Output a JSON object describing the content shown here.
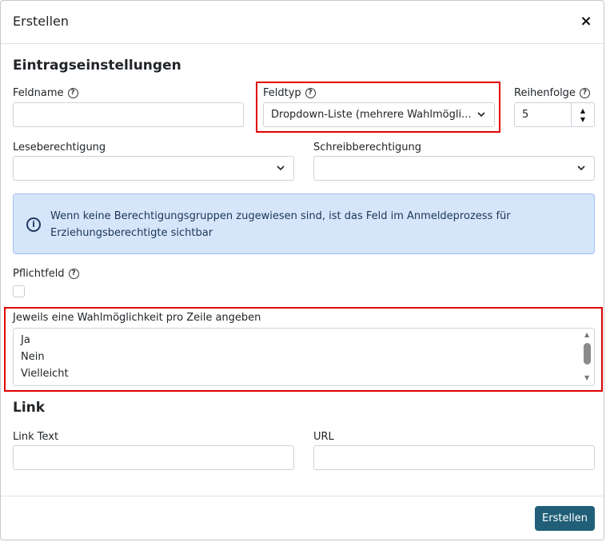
{
  "modal": {
    "title": "Erstellen",
    "close_label": "×"
  },
  "settings": {
    "section_title": "Eintragseinstellungen",
    "field_name": {
      "label": "Feldname",
      "value": ""
    },
    "field_type": {
      "label": "Feldtyp",
      "value": "Dropdown-Liste (mehrere Wahlmögli..."
    },
    "order": {
      "label": "Reihenfolge",
      "value": "5"
    },
    "read_permission": {
      "label": "Leseberechtigung",
      "value": ""
    },
    "write_permission": {
      "label": "Schreibberechtigung",
      "value": ""
    },
    "info_text": "Wenn keine Berechtigungsgruppen zugewiesen sind, ist das Feld im Anmeldeprozess für Erziehungsberechtigte sichtbar",
    "required": {
      "label": "Pflichtfeld",
      "checked": false
    },
    "options": {
      "label": "Jeweils eine Wahlmöglichkeit pro Zeile angeben",
      "lines": [
        "Ja",
        "Nein",
        "Vielleicht"
      ]
    }
  },
  "link": {
    "section_title": "Link",
    "text": {
      "label": "Link Text",
      "value": ""
    },
    "url": {
      "label": "URL",
      "value": ""
    }
  },
  "footer": {
    "submit_label": "Erstellen"
  },
  "colors": {
    "primary_button": "#215f78",
    "info_background": "#d5e6fb",
    "highlight": "#e00000"
  }
}
